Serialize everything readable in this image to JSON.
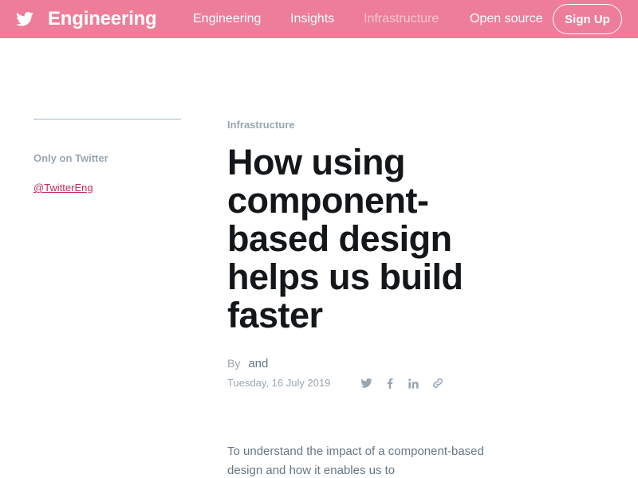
{
  "header": {
    "brand_icon": "twitter-bird-icon",
    "brand_label": "Engineering",
    "nav": [
      {
        "label": "Engineering"
      },
      {
        "label": "Insights"
      },
      {
        "label": "Infrastructure",
        "active": true
      },
      {
        "label": "Open source"
      }
    ],
    "signup_label": "Sign Up",
    "colors": {
      "background": "#ee7d9a",
      "text": "#ffffff",
      "active_text": "#f8c5d2"
    }
  },
  "sidebar": {
    "label": "Only on Twitter",
    "link": "@TwitterEng",
    "link_color": "#c72c5e"
  },
  "article": {
    "category": "Infrastructure",
    "title": "How using component-based design helps us build faster",
    "byline_prefix": "By",
    "byline_authors": "and",
    "date": "Tuesday, 16 July 2019",
    "share_icons": [
      "twitter-icon",
      "facebook-icon",
      "linkedin-icon",
      "link-icon"
    ],
    "intro": "To understand the impact of a component-based design and how it enables us to"
  }
}
